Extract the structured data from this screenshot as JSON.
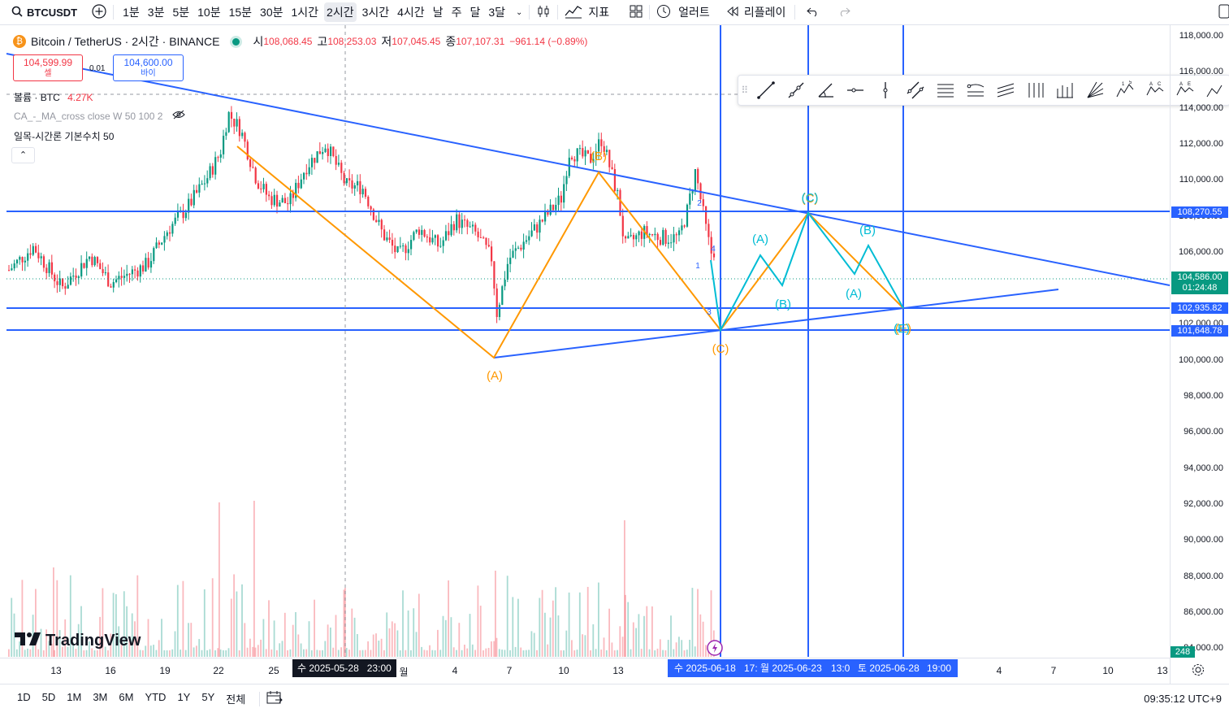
{
  "toolbar": {
    "symbol": "BTCUSDT",
    "intervals": [
      "1분",
      "3분",
      "5분",
      "10분",
      "15분",
      "30분",
      "1시간",
      "2시간",
      "3시간",
      "4시간",
      "날",
      "주",
      "달",
      "3달"
    ],
    "active_interval": "2시간",
    "indicators_label": "지표",
    "alert_label": "얼러트",
    "replay_label": "리플레이"
  },
  "legend": {
    "title": "Bitcoin / TetherUS · 2시간 · BINANCE",
    "open_k": "시",
    "open": "108,068.45",
    "high_k": "고",
    "high": "108,253.03",
    "low_k": "저",
    "low": "107,045.45",
    "close_k": "종",
    "close": "107,107.31",
    "change": "−961.14 (−0.89%)",
    "sell_price": "104,599.99",
    "sell_label": "셀",
    "spread": "0.01",
    "buy_price": "104,600.00",
    "buy_label": "바이",
    "volume_label": "볼륨 · BTC",
    "volume_value": "4.27K",
    "ma_cross": "CA_-_MA_cross close W 50 100 2",
    "ichimoku": "일목-시간론 기본수치 50"
  },
  "price_axis": {
    "ticks": [
      "118,000.00",
      "116,000.00",
      "114,000.00",
      "112,000.00",
      "110,000.00",
      "108,000.00",
      "106,000.00",
      "104,000.00",
      "102,000.00",
      "100,000.00",
      "98,000.00",
      "96,000.00",
      "94,000.00",
      "92,000.00",
      "90,000.00",
      "88,000.00",
      "86,000.00",
      "84,000.00"
    ],
    "labels": {
      "line1": "108,270.55",
      "current": "104,586.00",
      "countdown": "01:24:48",
      "line2": "102,935.82",
      "line3": "101,648.78",
      "volume": "248"
    }
  },
  "time_axis": {
    "ticks": [
      "13",
      "16",
      "19",
      "22",
      "25",
      "월",
      "4",
      "7",
      "10",
      "13",
      "4",
      "7",
      "10",
      "13"
    ],
    "crosshair_label": "수 2025-05-28   23:00",
    "marker_labels": [
      "수 2025-06-18",
      "17:",
      "월 2025-06-23",
      "13:0",
      "토 2025-06-28",
      "19:00"
    ]
  },
  "wave_labels": {
    "orange": [
      "(B)",
      "(A)",
      "(C)",
      "(C)",
      "(E)"
    ],
    "cyan": [
      "(A)",
      "(B)",
      "(C)",
      "(A)",
      "(B)",
      "(E)"
    ],
    "small": [
      "2",
      "4",
      "1",
      "3"
    ]
  },
  "bottom": {
    "ranges": [
      "1D",
      "5D",
      "1M",
      "3M",
      "6M",
      "YTD",
      "1Y",
      "5Y",
      "전체"
    ],
    "clock": "09:35:12 UTC+9"
  },
  "watermark": "TradingView",
  "colors": {
    "up": "#089981",
    "down": "#f23645",
    "blue": "#2962ff",
    "orange": "#ff9800",
    "cyan": "#00bcd4"
  }
}
